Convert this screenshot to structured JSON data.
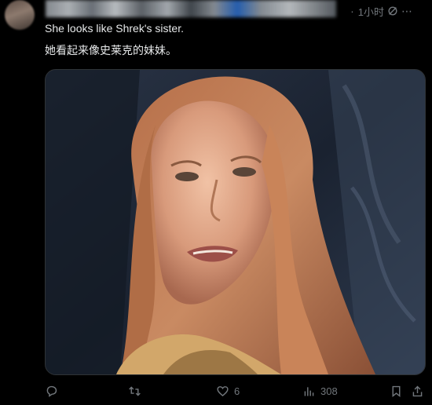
{
  "post": {
    "time": "1小时",
    "more": "·",
    "text_en": "She looks like Shrek's sister.",
    "text_zh": "她看起来像史莱克的妹妹。"
  },
  "actions": {
    "reply": "",
    "repost": "",
    "like_count": "6",
    "views_count": "308"
  },
  "colors": {
    "background": "#000000",
    "text": "#e7e9ea",
    "muted": "#71767b"
  }
}
